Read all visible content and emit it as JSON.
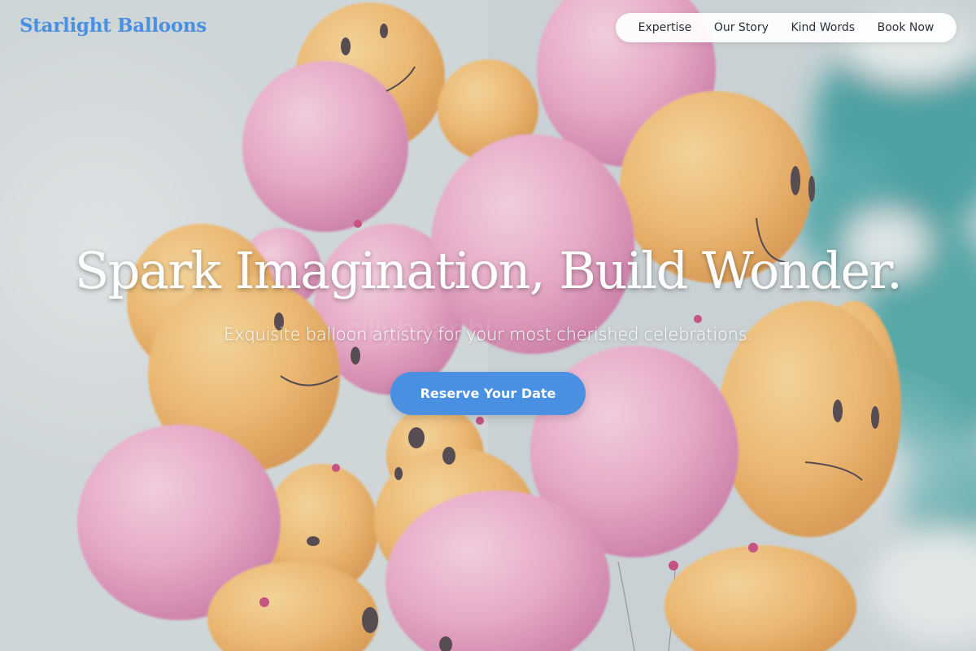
{
  "brand": {
    "name": "Starlight Balloons"
  },
  "nav": {
    "items": [
      {
        "label": "Expertise"
      },
      {
        "label": "Our Story"
      },
      {
        "label": "Kind Words"
      },
      {
        "label": "Book Now"
      }
    ]
  },
  "hero": {
    "title": "Spark Imagination, Build Wonder.",
    "subtitle": "Exquisite balloon artistry for your most cherished celebrations.",
    "cta_label": "Reserve Your Date"
  },
  "colors": {
    "accent": "#4a90e2",
    "nav_bg": "#ffffff",
    "nav_text": "#2a2f38",
    "hero_text": "#ffffff",
    "balloon_pink": "#e89ec3",
    "balloon_orange": "#f2b565",
    "sky": "#c9d3d7",
    "sky_teal": "#3a9b9a"
  }
}
